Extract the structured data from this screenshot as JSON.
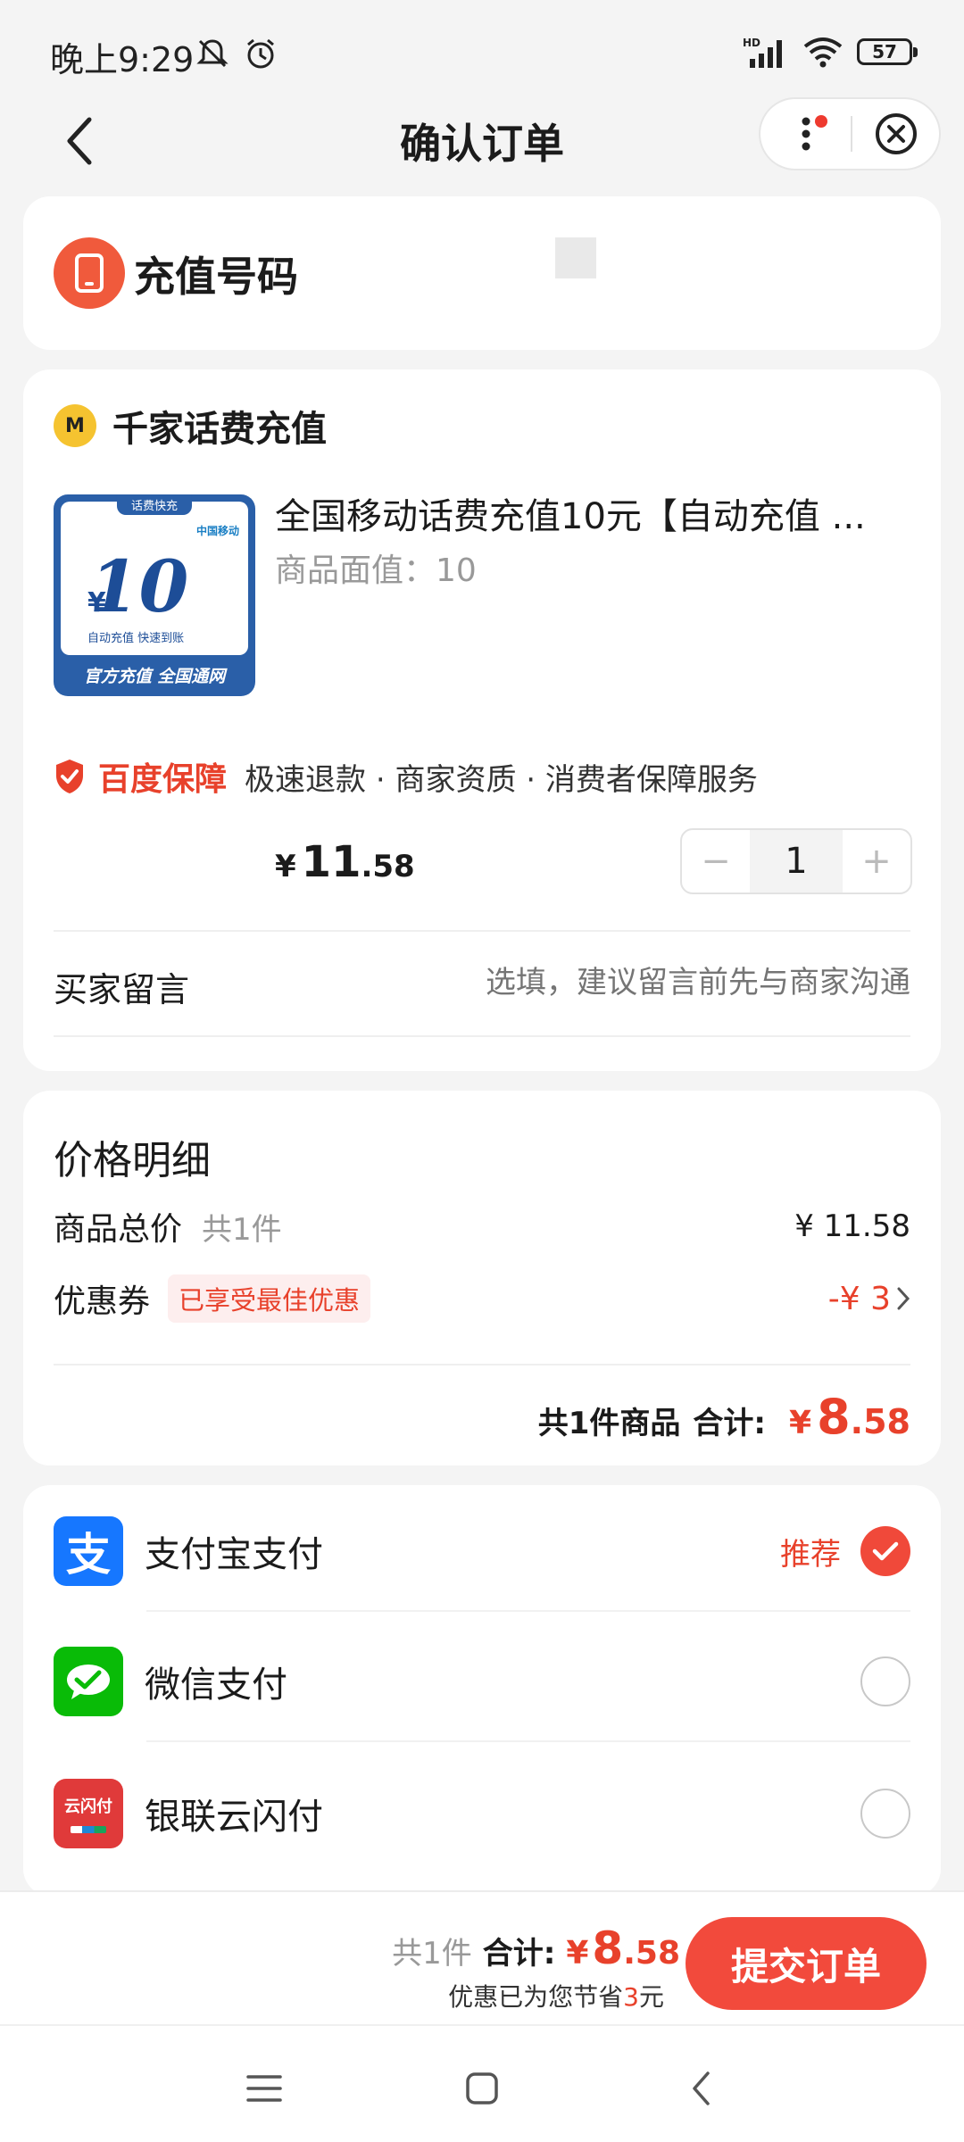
{
  "status": {
    "time": "晚上9:29",
    "battery": "57",
    "network": "HD"
  },
  "header": {
    "title": "确认订单"
  },
  "phone_section": {
    "title": "充值号码"
  },
  "shop": {
    "logo_letter": "M",
    "name": "千家话费充值"
  },
  "product": {
    "image_tag": "话费快充",
    "image_carrier": "中国移动",
    "image_amount": "10",
    "image_yen": "¥",
    "image_note": "自动充值 快速到账",
    "image_footer": "官方充值 全国通网",
    "title": "全国移动话费充值10元【自动充值 ...",
    "spec": "商品面值：10",
    "price_yen": "¥",
    "price_int": "11",
    "price_dec": ".58",
    "quantity": "1",
    "minus": "−",
    "plus": "+"
  },
  "guarantee": {
    "brand": "百度保障",
    "text": "极速退款 · 商家资质 · 消费者保障服务"
  },
  "buyer_message": {
    "label": "买家留言",
    "placeholder": "选填，建议留言前先与商家沟通"
  },
  "price_detail": {
    "title": "价格明细",
    "goods_total_label": "商品总价",
    "goods_total_count": "共1件",
    "goods_total_value": "¥ 11.58",
    "coupon_label": "优惠券",
    "coupon_tag": "已享受最佳优惠",
    "coupon_value": "-¥ 3",
    "summary_count": "共1件商品",
    "summary_label": "合计:",
    "summary_yen": "¥",
    "summary_int": "8",
    "summary_dec": ".58"
  },
  "payment": {
    "methods": [
      {
        "name": "支付宝支付",
        "badge": "推荐",
        "selected": true
      },
      {
        "name": "微信支付",
        "selected": false
      },
      {
        "name": "银联云闪付",
        "selected": false
      }
    ],
    "unionpay_logo": "云闪付",
    "alipay_logo": "支",
    "colors": {
      "alipay": "#1677ff",
      "wechat": "#09bb07",
      "unionpay": "#e03a3a",
      "accent": "#f24a3c"
    }
  },
  "bottom": {
    "count": "共1件",
    "total_label": "合计:",
    "yen": "¥",
    "total_int": "8",
    "total_dec": ".58",
    "save_prefix": "优惠已为您节省",
    "save_amount": "3",
    "save_suffix": "元",
    "submit": "提交订单"
  }
}
